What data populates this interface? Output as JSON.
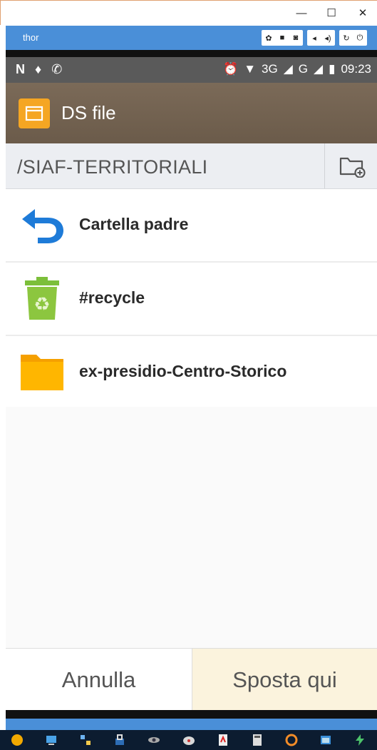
{
  "window": {
    "minimize_glyph": "—",
    "maximize_glyph": "☐",
    "close_glyph": "✕"
  },
  "emulator": {
    "title": "thor",
    "tools": [
      "gear-icon",
      "camera-video-icon",
      "camera-icon",
      "volume-down-icon",
      "volume-up-icon",
      "rotate-icon",
      "power-icon"
    ]
  },
  "statusbar": {
    "left_icons": [
      "n-icon",
      "key-icon",
      "whatsapp-icon"
    ],
    "network_3g": "3G",
    "network_g": "G",
    "time": "09:23"
  },
  "appbar": {
    "title": "DS file",
    "icon": "folder-icon",
    "brand_color": "#f5a623",
    "bar_color": "#6b5b4a"
  },
  "path": {
    "current": "/SIAF-TERRITORIALI",
    "new_folder_icon": "new-folder-icon"
  },
  "list": {
    "items": [
      {
        "label": "Cartella padre",
        "icon": "back-arrow-icon"
      },
      {
        "label": "#recycle",
        "icon": "recycle-bin-icon"
      },
      {
        "label": "ex-presidio-Centro-Storico",
        "icon": "folder-icon"
      }
    ]
  },
  "actions": {
    "cancel": "Annulla",
    "move_here": "Sposta qui"
  },
  "taskbar": {
    "apps": [
      "app-1",
      "app-2",
      "app-3",
      "app-4",
      "app-5",
      "app-6",
      "app-7",
      "app-8",
      "app-9",
      "app-10",
      "app-11"
    ]
  }
}
